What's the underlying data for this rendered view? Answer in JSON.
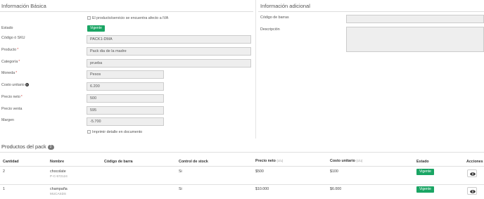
{
  "basic": {
    "title": "Información Básica",
    "iva_label": "El producto/servicio se encuentra afecto a IVA",
    "fields": [
      {
        "label": "Estado"
      },
      {
        "label": "Código ó SKU",
        "value": "PACK1-DMA"
      },
      {
        "label": "Producto",
        "value": "Pack dia de la madre"
      },
      {
        "label": "Categoría",
        "value": "prueba"
      },
      {
        "label": "Moneda",
        "value": "Pesos"
      },
      {
        "label": "Costo unitario",
        "value": "6.200"
      },
      {
        "label": "Precio neto",
        "value": "500"
      },
      {
        "label": "Precio venta",
        "value": "595"
      },
      {
        "label": "Margen",
        "value": "-5.700"
      }
    ],
    "status_badge": "Vigente",
    "print_detail_label": "Imprimir detalle en documento"
  },
  "additional": {
    "title": "Información adicional",
    "barcode_label": "Código de barras",
    "description_label": "Descripción"
  },
  "pack": {
    "title": "Productos del pack",
    "count": "2",
    "columns": [
      "Cantidad",
      "Nombre",
      "Código de barra",
      "Control de stock",
      "Precio neto",
      "Costo unitario",
      "Estado",
      "Acciones"
    ],
    "unit_suffix": "(c/u)",
    "rows": [
      {
        "qty": "2",
        "name": "chocolate",
        "sku": "P-C-572124",
        "barcode": "",
        "stock": "Si",
        "price": "$500",
        "cost": "$100",
        "status": "Vigente"
      },
      {
        "qty": "1",
        "name": "champaña",
        "sku": "MUCASDS",
        "barcode": "",
        "stock": "Si",
        "price": "$10.000",
        "cost": "$6.000",
        "status": "Vigente"
      }
    ]
  },
  "icons": {
    "help": "question-circle-icon",
    "view": "eye-icon"
  }
}
